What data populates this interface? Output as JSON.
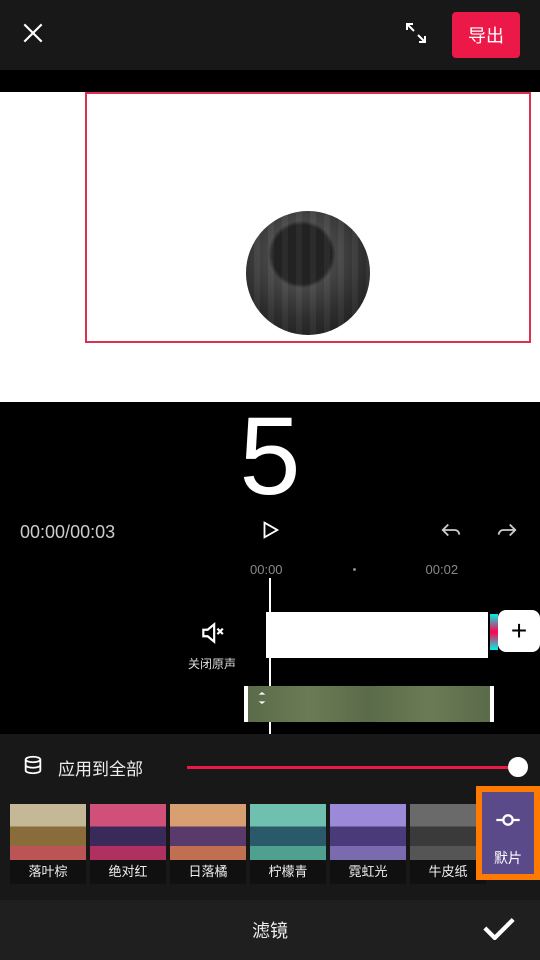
{
  "top": {
    "export_label": "导出"
  },
  "preview": {
    "countdown": "5"
  },
  "time": {
    "current": "00:00",
    "total": "00:03"
  },
  "timeline": {
    "tick0": "00:00",
    "tick1": "00:02",
    "close_audio_label": "关闭原声"
  },
  "filter_panel": {
    "apply_all_label": "应用到全部",
    "bottom_label": "滤镜",
    "selected_label": "默片",
    "items": [
      {
        "name": "落叶棕"
      },
      {
        "name": "绝对红"
      },
      {
        "name": "日落橘"
      },
      {
        "name": "柠檬青"
      },
      {
        "name": "霓虹光"
      },
      {
        "name": "牛皮纸"
      }
    ]
  }
}
